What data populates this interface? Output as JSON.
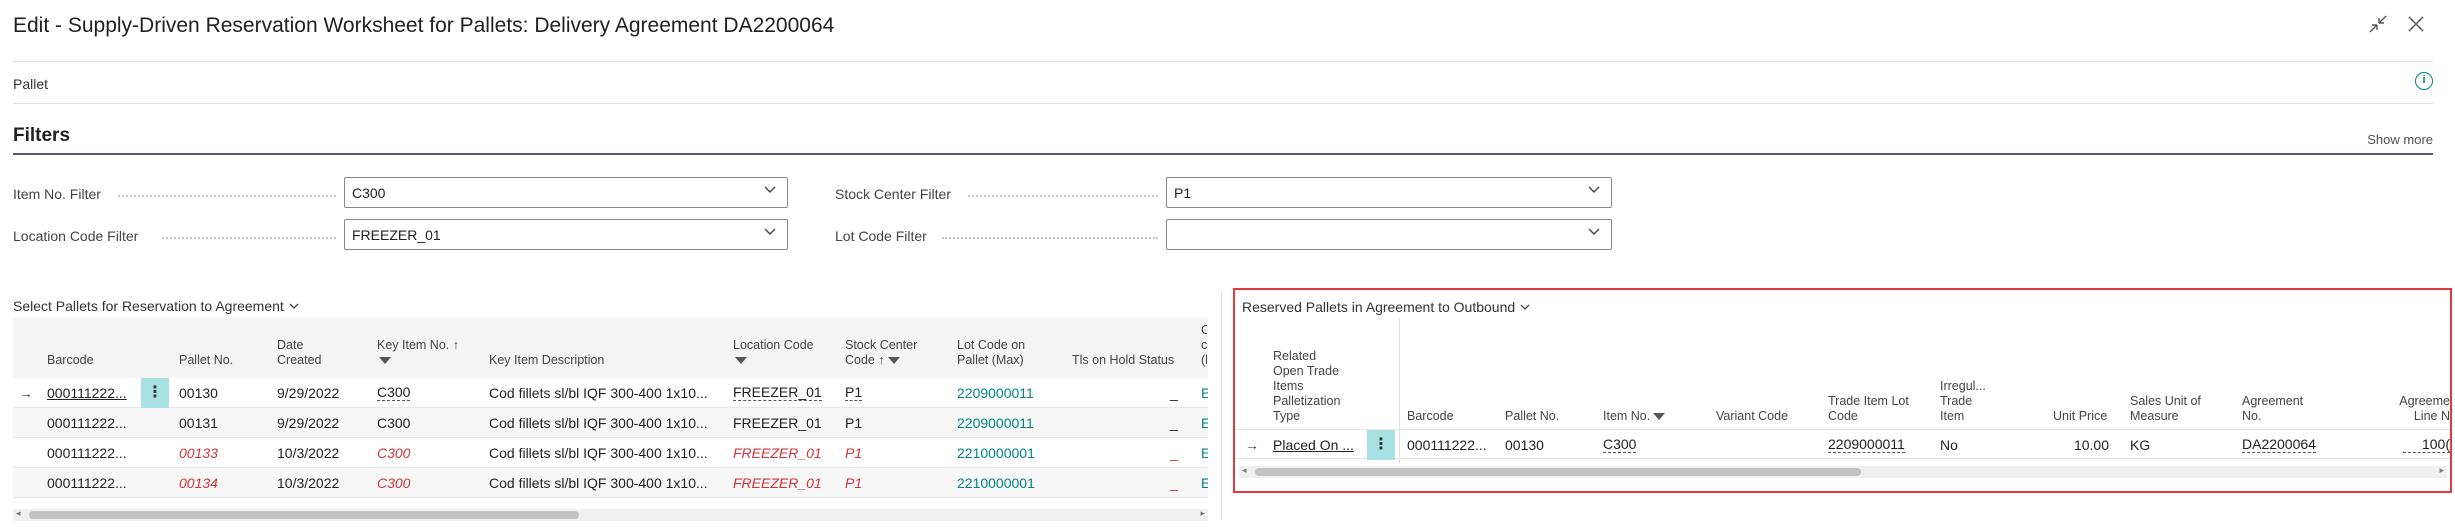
{
  "window": {
    "title": "Edit - Supply-Driven Reservation Worksheet for Pallets: Delivery Agreement DA2200064",
    "collapse_icon": "collapse-icon",
    "close_icon": "close-icon"
  },
  "header": {
    "pallet_label": "Pallet",
    "info_icon_glyph": "i"
  },
  "filters": {
    "title": "Filters",
    "show_more": "Show more",
    "item_no_label": "Item No. Filter",
    "item_no_value": "C300",
    "location_label": "Location Code Filter",
    "location_value": "FREEZER_01",
    "stock_center_label": "Stock Center Filter",
    "stock_center_value": "P1",
    "lot_code_label": "Lot Code Filter",
    "lot_code_value": ""
  },
  "left_part": {
    "caption": "Select Pallets for Reservation to Agreement",
    "columns": {
      "barcode": "Barcode",
      "pallet_no": "Pallet No.",
      "date_created_1": "Date",
      "date_created_2": "Created",
      "key_item_no": "Key Item No. ↑",
      "key_item_desc": "Key Item Description",
      "location_code": "Location Code",
      "stock_center_1": "Stock Center",
      "stock_center_2": "Code ↑",
      "lot_code_1": "Lot Code on",
      "lot_code_2": "Pallet (Max)",
      "tls_hold": "Tls on Hold Status",
      "cut_1": "C",
      "cut_2": "c",
      "cut_3": "(l"
    },
    "rows": [
      {
        "barcode": "000111222...",
        "pallet_no": "00130",
        "date": "9/29/2022",
        "item_no": "C300",
        "desc": "Cod fillets sl/bl IQF 300-400 1x10...",
        "location": "FREEZER_01",
        "stock_center": "P1",
        "lot_code": "2209000011",
        "tls": "_",
        "cut": "E",
        "style": "normal"
      },
      {
        "barcode": "000111222...",
        "pallet_no": "00131",
        "date": "9/29/2022",
        "item_no": "C300",
        "desc": "Cod fillets sl/bl IQF 300-400 1x10...",
        "location": "FREEZER_01",
        "stock_center": "P1",
        "lot_code": "2209000011",
        "tls": "_",
        "cut": "E",
        "style": "normal"
      },
      {
        "barcode": "000111222...",
        "pallet_no": "00133",
        "date": "10/3/2022",
        "item_no": "C300",
        "desc": "Cod fillets sl/bl IQF 300-400 1x10...",
        "location": "FREEZER_01",
        "stock_center": "P1",
        "lot_code": "2210000001",
        "tls": "_",
        "cut": "E",
        "style": "red"
      },
      {
        "barcode": "000111222...",
        "pallet_no": "00134",
        "date": "10/3/2022",
        "item_no": "C300",
        "desc": "Cod fillets sl/bl IQF 300-400 1x10...",
        "location": "FREEZER_01",
        "stock_center": "P1",
        "lot_code": "2210000001",
        "tls": "_",
        "cut": "E",
        "style": "red"
      }
    ]
  },
  "right_part": {
    "caption": "Reserved Pallets in Agreement to Outbound",
    "columns": {
      "related_1": "Related",
      "related_2": "Open Trade",
      "related_3": "Items",
      "related_4": "Palletization",
      "related_5": "Type",
      "barcode": "Barcode",
      "pallet_no": "Pallet No.",
      "item_no": "Item No.",
      "variant_code": "Variant Code",
      "trade_lot_1": "Trade Item Lot",
      "trade_lot_2": "Code",
      "irregular_1": "Irregul...",
      "irregular_2": "Trade",
      "irregular_3": "Item",
      "unit_price": "Unit Price",
      "sales_uom_1": "Sales Unit of",
      "sales_uom_2": "Measure",
      "agreement_no_1": "Agreement",
      "agreement_no_2": "No.",
      "agreement_line_1": "Agreeme",
      "agreement_line_2": "Line N"
    },
    "rows": [
      {
        "related": "Placed On ...",
        "barcode": "000111222...",
        "pallet_no": "00130",
        "item_no": "C300",
        "variant": "",
        "trade_lot": "2209000011",
        "irregular": "No",
        "unit_price": "10.00",
        "sales_uom": "KG",
        "agreement_no": "DA2200064",
        "agreement_line": "100("
      }
    ]
  }
}
